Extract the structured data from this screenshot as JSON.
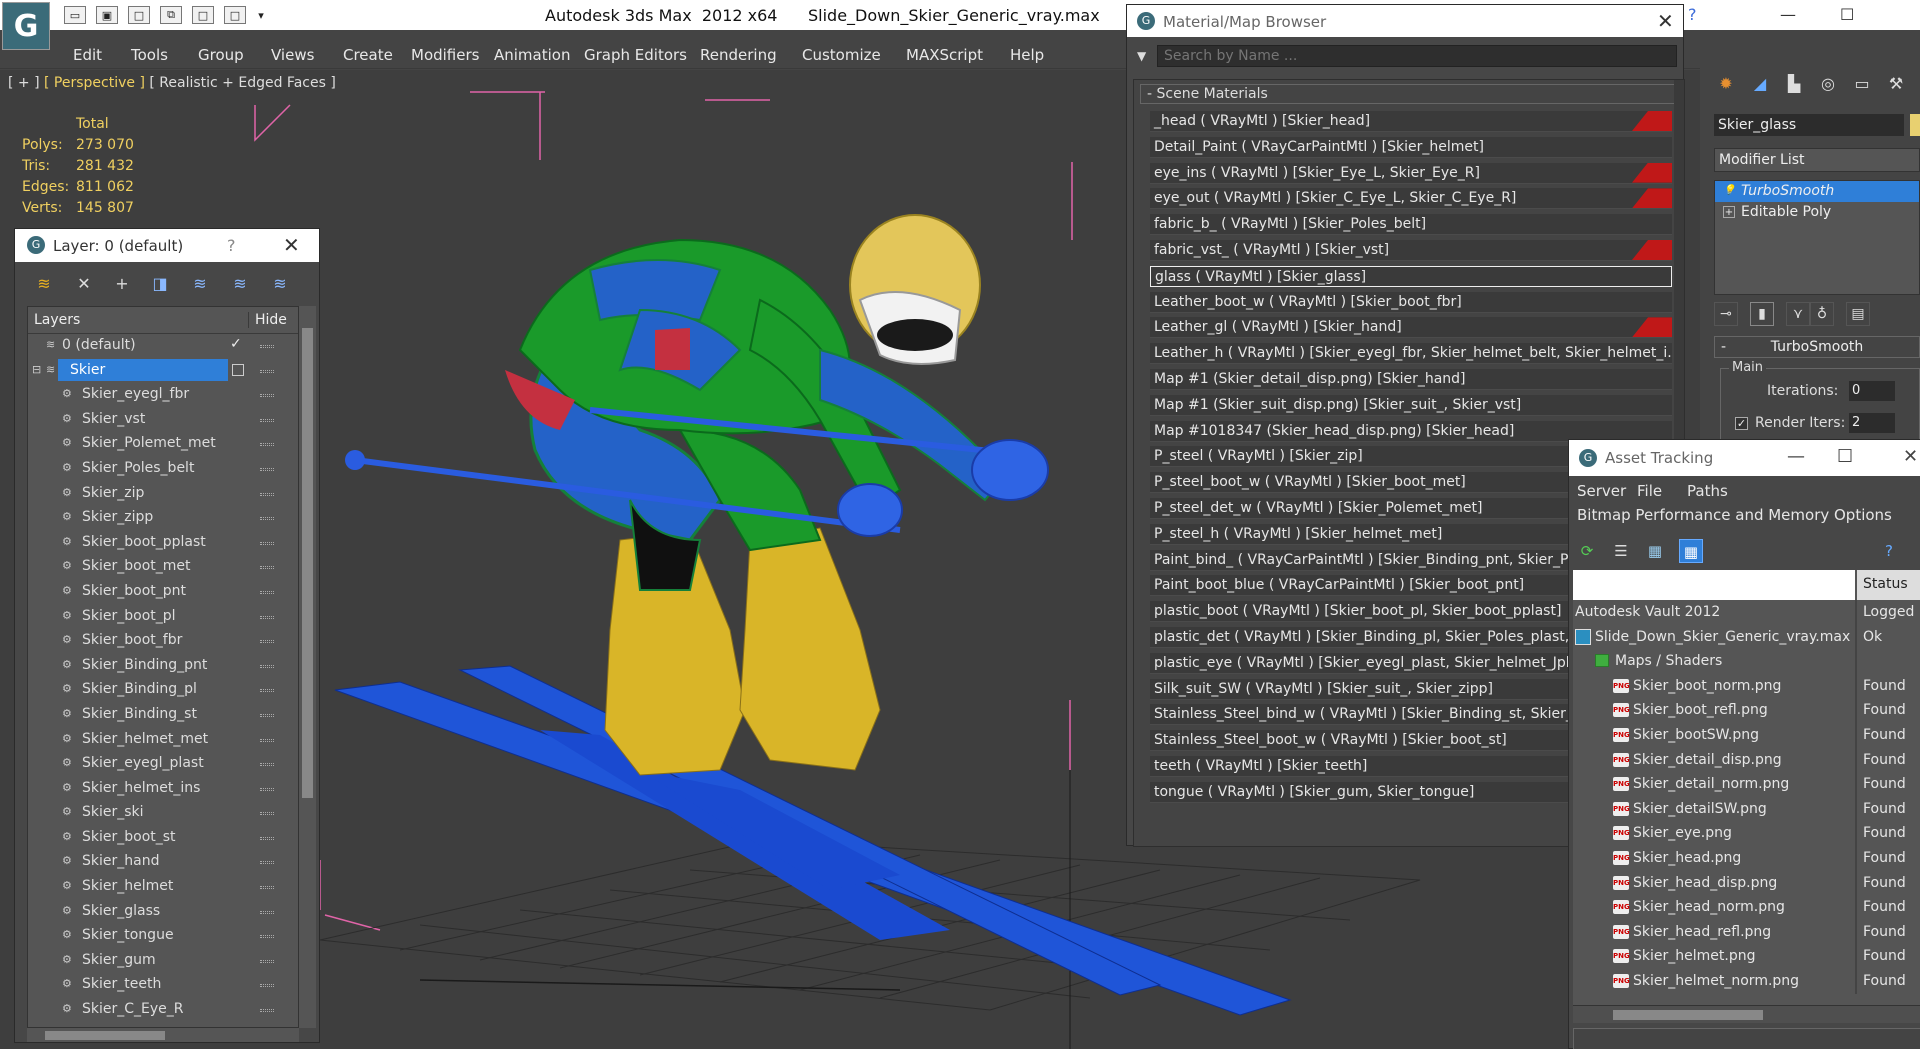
{
  "app": {
    "title": "Autodesk 3ds Max  2012 x64      Slide_Down_Skier_Generic_vray.max",
    "logo": "3ds-max-logo"
  },
  "menu": [
    "Edit",
    "Tools",
    "Group",
    "Views",
    "Create",
    "Modifiers",
    "Animation",
    "Graph Editors",
    "Rendering",
    "Customize",
    "MAXScript",
    "Help"
  ],
  "viewport": {
    "label_plus": "[ + ]",
    "label_view": "[ Perspective ]",
    "label_mode": "[ Realistic + Edged Faces ]",
    "stats": {
      "header": "Total",
      "rows": [
        {
          "key": "Polys:",
          "value": "273 070"
        },
        {
          "key": "Tris:",
          "value": "281 432"
        },
        {
          "key": "Edges:",
          "value": "811 062"
        },
        {
          "key": "Verts:",
          "value": "145 807"
        }
      ]
    }
  },
  "layer_dialog": {
    "title": "Layer: 0 (default)",
    "help": "?",
    "close": "✕",
    "col_layers": "Layers",
    "col_hide": "Hide",
    "rows": [
      {
        "name": "0 (default)",
        "indent": 1,
        "check": "✓"
      },
      {
        "name": "Skier",
        "indent": 1,
        "selected": true
      },
      {
        "name": "Skier_eyegl_fbr",
        "indent": 2
      },
      {
        "name": "Skier_vst",
        "indent": 2
      },
      {
        "name": "Skier_Polemet_met",
        "indent": 2
      },
      {
        "name": "Skier_Poles_belt",
        "indent": 2
      },
      {
        "name": "Skier_zip",
        "indent": 2
      },
      {
        "name": "Skier_zipp",
        "indent": 2
      },
      {
        "name": "Skier_boot_pplast",
        "indent": 2
      },
      {
        "name": "Skier_boot_met",
        "indent": 2
      },
      {
        "name": "Skier_boot_pnt",
        "indent": 2
      },
      {
        "name": "Skier_boot_pl",
        "indent": 2
      },
      {
        "name": "Skier_boot_fbr",
        "indent": 2
      },
      {
        "name": "Skier_Binding_pnt",
        "indent": 2
      },
      {
        "name": "Skier_Binding_pl",
        "indent": 2
      },
      {
        "name": "Skier_Binding_st",
        "indent": 2
      },
      {
        "name": "Skier_helmet_met",
        "indent": 2
      },
      {
        "name": "Skier_eyegl_plast",
        "indent": 2
      },
      {
        "name": "Skier_helmet_ins",
        "indent": 2
      },
      {
        "name": "Skier_ski",
        "indent": 2
      },
      {
        "name": "Skier_boot_st",
        "indent": 2
      },
      {
        "name": "Skier_hand",
        "indent": 2
      },
      {
        "name": "Skier_helmet",
        "indent": 2
      },
      {
        "name": "Skier_glass",
        "indent": 2
      },
      {
        "name": "Skier_tongue",
        "indent": 2
      },
      {
        "name": "Skier_gum",
        "indent": 2
      },
      {
        "name": "Skier_teeth",
        "indent": 2
      },
      {
        "name": "Skier_C_Eye_R",
        "indent": 2
      }
    ]
  },
  "material_browser": {
    "title": "Material/Map Browser",
    "close": "✕",
    "search_placeholder": "Search by Name ...",
    "section": "- Scene Materials",
    "rows": [
      {
        "text": "_head  ( VRayMtl ) [Skier_head]",
        "red": true
      },
      {
        "text": "Detail_Paint  ( VRayCarPaintMtl ) [Skier_helmet]",
        "red": false
      },
      {
        "text": "eye_ins  ( VRayMtl ) [Skier_Eye_L, Skier_Eye_R]",
        "red": true
      },
      {
        "text": "eye_out  ( VRayMtl ) [Skier_C_Eye_L, Skier_C_Eye_R]",
        "red": true
      },
      {
        "text": "fabric_b_  ( VRayMtl ) [Skier_Poles_belt]",
        "red": false
      },
      {
        "text": "fabric_vst_  ( VRayMtl ) [Skier_vst]",
        "red": true
      },
      {
        "text": "glass  ( VRayMtl ) [Skier_glass]",
        "red": false,
        "selected": true
      },
      {
        "text": "Leather_boot_w  ( VRayMtl ) [Skier_boot_fbr]",
        "red": false
      },
      {
        "text": "Leather_gl  ( VRayMtl ) [Skier_hand]",
        "red": true
      },
      {
        "text": "Leather_h  ( VRayMtl ) [Skier_eyegl_fbr, Skier_helmet_belt, Skier_helmet_i...",
        "red": false
      },
      {
        "text": "Map #1 (Skier_detail_disp.png) [Skier_hand]",
        "red": false
      },
      {
        "text": "Map #1 (Skier_suit_disp.png) [Skier_suit_, Skier_vst]",
        "red": false
      },
      {
        "text": "Map #1018347 (Skier_head_disp.png) [Skier_head]",
        "red": false
      },
      {
        "text": "P_steel  ( VRayMtl ) [Skier_zip]",
        "red": false
      },
      {
        "text": "P_steel_boot_w  ( VRayMtl ) [Skier_boot_met]",
        "red": false
      },
      {
        "text": "P_steel_det_w  ( VRayMtl ) [Skier_Polemet_met]",
        "red": false
      },
      {
        "text": "P_steel_h  ( VRayMtl ) [Skier_helmet_met]",
        "red": false
      },
      {
        "text": "Paint_bind_  ( VRayCarPaintMtl ) [Skier_Binding_pnt, Skier_Pol",
        "red": false
      },
      {
        "text": "Paint_boot_blue  ( VRayCarPaintMtl ) [Skier_boot_pnt]",
        "red": false
      },
      {
        "text": "plastic_boot ( VRayMtl ) [Skier_boot_pl, Skier_boot_pplast]",
        "red": false
      },
      {
        "text": "plastic_det  ( VRayMtl ) [Skier_Binding_pl, Skier_Poles_plast, Sl",
        "red": false
      },
      {
        "text": "plastic_eye  ( VRayMtl ) [Skier_eyegl_plast, Skier_helmet_Jplas",
        "red": false
      },
      {
        "text": "Silk_suit_SW  ( VRayMtl ) [Skier_suit_, Skier_zipp]",
        "red": false
      },
      {
        "text": "Stainless_Steel_bind_w  ( VRayMtl ) [Skier_Binding_st, Skier_Po",
        "red": false
      },
      {
        "text": "Stainless_Steel_boot_w  ( VRayMtl ) [Skier_boot_st]",
        "red": false
      },
      {
        "text": "teeth  ( VRayMtl ) [Skier_teeth]",
        "red": false
      },
      {
        "text": "tongue  ( VRayMtl ) [Skier_gum, Skier_tongue]",
        "red": false
      }
    ]
  },
  "command_panel": {
    "object_name": "Skier_glass",
    "modifier_list": "Modifier List",
    "stack": [
      {
        "name": "TurboSmooth",
        "selected": true
      },
      {
        "name": "Editable Poly",
        "selected": false
      }
    ],
    "rollout": "TurboSmooth",
    "group_main": "Main",
    "iterations_label": "Iterations:",
    "iterations_value": "0",
    "render_iters_label": "Render Iters:",
    "render_iters_value": "2"
  },
  "asset_tracking": {
    "title": "Asset Tracking",
    "menu1": [
      "Server",
      "File",
      "Paths"
    ],
    "menu2": [
      "Bitmap Performance and Memory",
      "Options"
    ],
    "col_status": "Status",
    "rows": [
      {
        "name": "Autodesk Vault 2012",
        "status": "Logged",
        "indent": 0,
        "icon": "none"
      },
      {
        "name": "Slide_Down_Skier_Generic_vray.max",
        "status": "Ok",
        "indent": 0,
        "icon": "max-file-icon"
      },
      {
        "name": "Maps / Shaders",
        "status": "",
        "indent": 1,
        "icon": "folder-icon"
      },
      {
        "name": "Skier_boot_norm.png",
        "status": "Found",
        "indent": 2,
        "icon": "png-icon"
      },
      {
        "name": "Skier_boot_refl.png",
        "status": "Found",
        "indent": 2,
        "icon": "png-icon"
      },
      {
        "name": "Skier_bootSW.png",
        "status": "Found",
        "indent": 2,
        "icon": "png-icon"
      },
      {
        "name": "Skier_detail_disp.png",
        "status": "Found",
        "indent": 2,
        "icon": "png-icon"
      },
      {
        "name": "Skier_detail_norm.png",
        "status": "Found",
        "indent": 2,
        "icon": "png-icon"
      },
      {
        "name": "Skier_detailSW.png",
        "status": "Found",
        "indent": 2,
        "icon": "png-icon"
      },
      {
        "name": "Skier_eye.png",
        "status": "Found",
        "indent": 2,
        "icon": "png-icon"
      },
      {
        "name": "Skier_head.png",
        "status": "Found",
        "indent": 2,
        "icon": "png-icon"
      },
      {
        "name": "Skier_head_disp.png",
        "status": "Found",
        "indent": 2,
        "icon": "png-icon"
      },
      {
        "name": "Skier_head_norm.png",
        "status": "Found",
        "indent": 2,
        "icon": "png-icon"
      },
      {
        "name": "Skier_head_refl.png",
        "status": "Found",
        "indent": 2,
        "icon": "png-icon"
      },
      {
        "name": "Skier_helmet.png",
        "status": "Found",
        "indent": 2,
        "icon": "png-icon"
      },
      {
        "name": "Skier_helmet_norm.png",
        "status": "Found",
        "indent": 2,
        "icon": "png-icon"
      }
    ]
  },
  "colors": {
    "selection": "#2f7fd8",
    "stats": "#f0d060",
    "material_flag": "#c01818",
    "suit_green": "#1a9a2a",
    "suit_blue": "#2462c8",
    "boot_yellow": "#d9b528",
    "ski_blue": "#1f55d8"
  }
}
